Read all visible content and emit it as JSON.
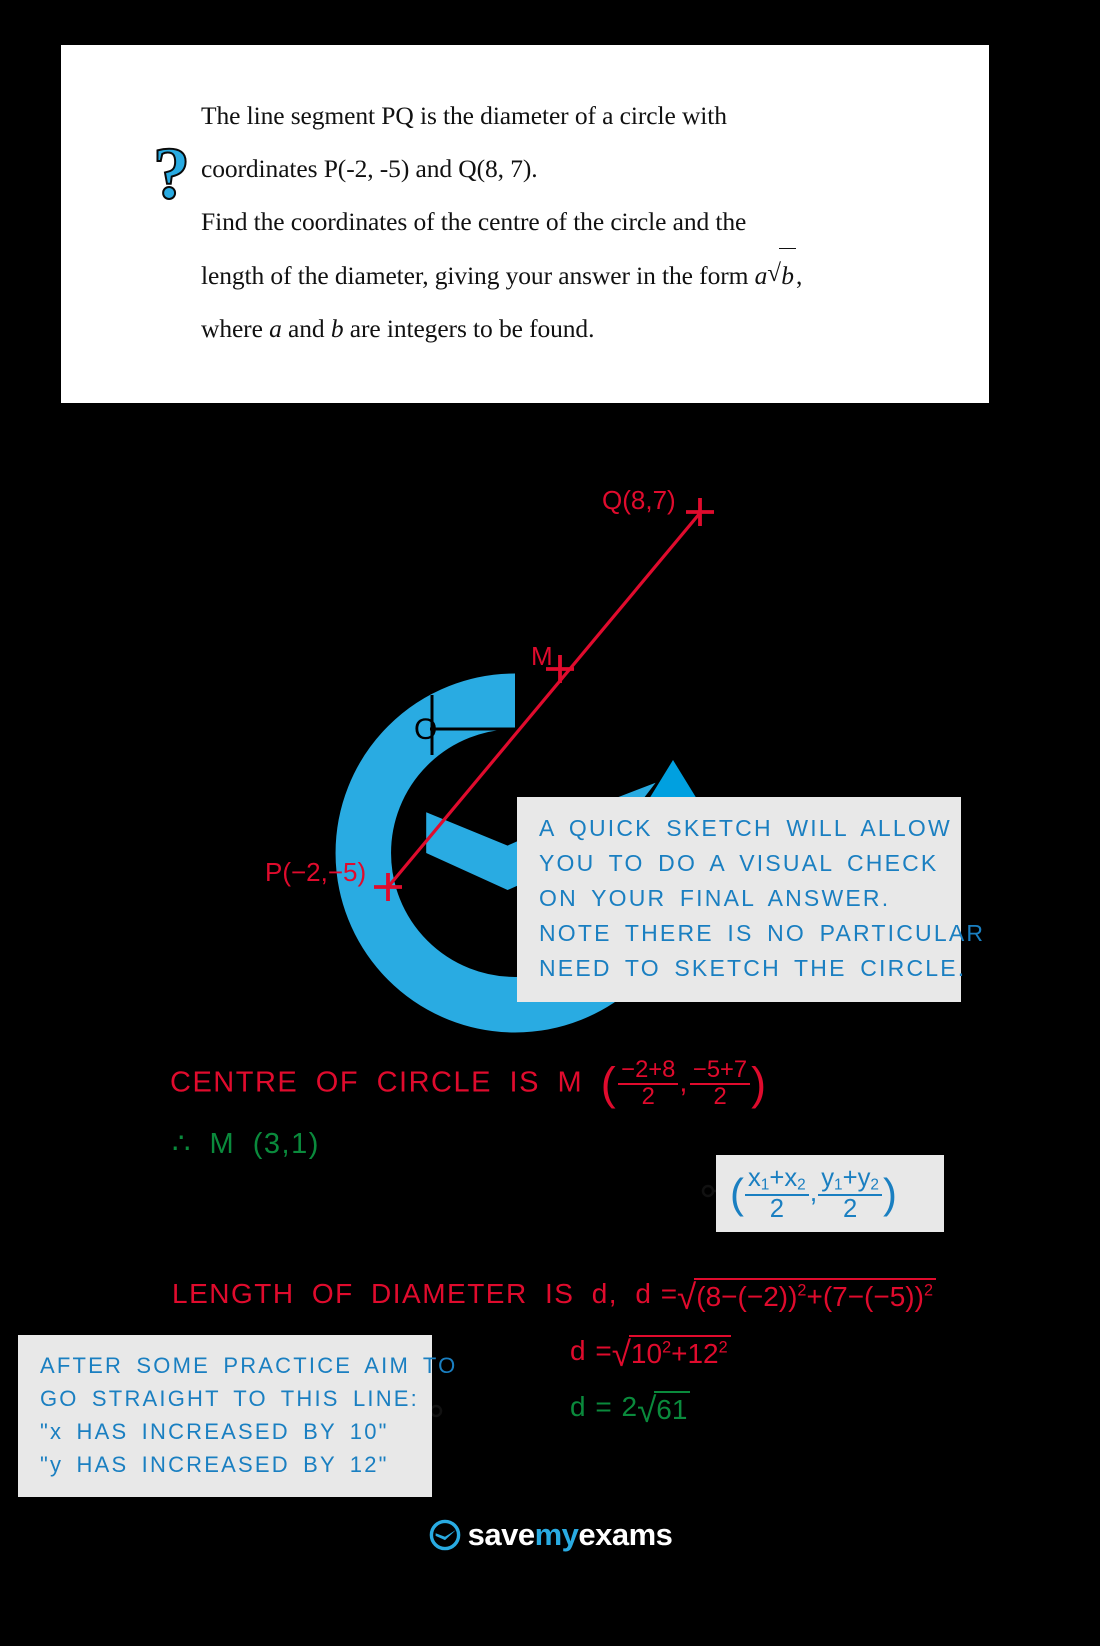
{
  "question": {
    "icon": "question-mark-icon",
    "lines": [
      "The line segment PQ is the diameter of a circle with",
      "coordinates P(-2, -5) and Q(8, 7).",
      "Find the coordinates of the centre of the circle and the",
      "length of the diameter, giving your answer in the form",
      "where a and b are integers to be found."
    ],
    "line4_prefix": "length of the diameter, giving your answer in the form ",
    "line4_math_a": "a",
    "line4_math_b": "b",
    "line4_suffix": ",",
    "line5_prefix": "where ",
    "line5_a": "a",
    "line5_mid": " and ",
    "line5_b": "b",
    "line5_suffix": " are integers to be found."
  },
  "graph": {
    "label_q": "Q(8,7)",
    "label_m": "M",
    "label_p": "P(−2,−5)",
    "label_origin": "O",
    "line_color": "#e00b2d",
    "axis_color": "#000000"
  },
  "tooltip_sketch": {
    "lines": [
      "A  QUICK  SKETCH  WILL  ALLOW",
      "YOU  TO  DO  A  VISUAL  CHECK",
      "ON  YOUR  FINAL  ANSWER.",
      "NOTE  THERE  IS  NO  PARTICULAR",
      "NEED  TO  SKETCH  THE  CIRCLE."
    ]
  },
  "tooltip_practice": {
    "lines": [
      "AFTER  SOME  PRACTICE  AIM  TO",
      "GO  STRAIGHT  TO  THIS  LINE:",
      "\"x  HAS  INCREASED  BY  10\"",
      "\"y  HAS  INCREASED  BY  12\""
    ]
  },
  "formula_box": {
    "x_num": "x",
    "x_sub1": "1",
    "plus": "+",
    "x_sub2": "2",
    "y_num": "y",
    "denominator": "2",
    "comma": ","
  },
  "working": {
    "centre_label": "CENTRE  OF  CIRCLE  IS  M",
    "centre_x_num": "−2+8",
    "centre_x_den": "2",
    "centre_y_num": "−5+7",
    "centre_y_den": "2",
    "therefore_m": "∴ M (3,1)",
    "length_label": "LENGTH  OF  DIAMETER  IS  d,",
    "d_eq": "d =",
    "d_line1_radicand": "(8−(−2))²+(7−(−5))²",
    "d_line1_inner": "(8−(−2))",
    "d_line1_inner2": "(7−(−5))",
    "d_line2_radicand_a": "10",
    "d_line2_radicand_b": "12",
    "d_line3": "2",
    "d_line3_radicand": "61",
    "sqrt_symbol": "√",
    "colors": {
      "red": "#e00b2d",
      "green": "#0a8a3c",
      "blue": "#1a7fc1"
    }
  },
  "footer": {
    "save": "save",
    "my": "my",
    "exams": "exams"
  }
}
